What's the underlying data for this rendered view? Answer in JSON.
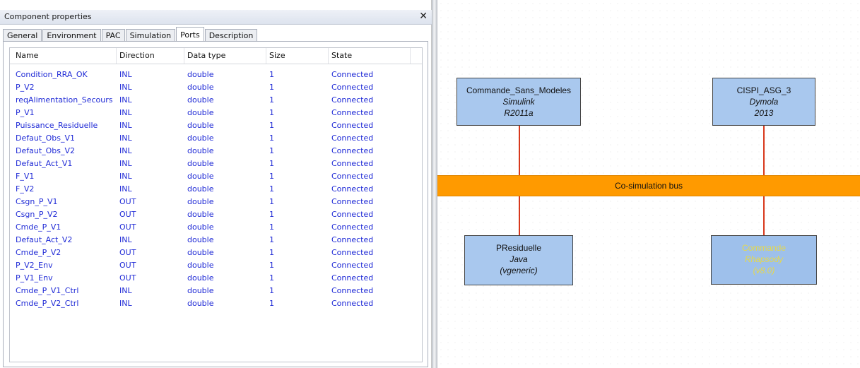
{
  "panel": {
    "title": "Component properties",
    "close_glyph": "✕",
    "tabs": [
      {
        "label": "General",
        "active": false
      },
      {
        "label": "Environment",
        "active": false
      },
      {
        "label": "PAC",
        "active": false
      },
      {
        "label": "Simulation",
        "active": false
      },
      {
        "label": "Ports",
        "active": true
      },
      {
        "label": "Description",
        "active": false
      }
    ]
  },
  "ports_table": {
    "columns": [
      "Name",
      "Direction",
      "Data type",
      "Size",
      "State"
    ],
    "rows": [
      [
        "Condition_RRA_OK",
        "INL",
        "double",
        "1",
        "Connected"
      ],
      [
        "P_V2",
        "INL",
        "double",
        "1",
        "Connected"
      ],
      [
        "reqAlimentation_Secours",
        "INL",
        "double",
        "1",
        "Connected"
      ],
      [
        "P_V1",
        "INL",
        "double",
        "1",
        "Connected"
      ],
      [
        "Puissance_Residuelle",
        "INL",
        "double",
        "1",
        "Connected"
      ],
      [
        "Defaut_Obs_V1",
        "INL",
        "double",
        "1",
        "Connected"
      ],
      [
        "Defaut_Obs_V2",
        "INL",
        "double",
        "1",
        "Connected"
      ],
      [
        "Defaut_Act_V1",
        "INL",
        "double",
        "1",
        "Connected"
      ],
      [
        "F_V1",
        "INL",
        "double",
        "1",
        "Connected"
      ],
      [
        "F_V2",
        "INL",
        "double",
        "1",
        "Connected"
      ],
      [
        "Csgn_P_V1",
        "OUT",
        "double",
        "1",
        "Connected"
      ],
      [
        "Csgn_P_V2",
        "OUT",
        "double",
        "1",
        "Connected"
      ],
      [
        "Cmde_P_V1",
        "OUT",
        "double",
        "1",
        "Connected"
      ],
      [
        "Defaut_Act_V2",
        "INL",
        "double",
        "1",
        "Connected"
      ],
      [
        "Cmde_P_V2",
        "OUT",
        "double",
        "1",
        "Connected"
      ],
      [
        "P_V2_Env",
        "OUT",
        "double",
        "1",
        "Connected"
      ],
      [
        "P_V1_Env",
        "OUT",
        "double",
        "1",
        "Connected"
      ],
      [
        "Cmde_P_V1_Ctrl",
        "INL",
        "double",
        "1",
        "Connected"
      ],
      [
        "Cmde_P_V2_Ctrl",
        "INL",
        "double",
        "1",
        "Connected"
      ]
    ]
  },
  "diagram": {
    "bus_label": "Co-simulation bus",
    "bus_color": "#ff9a00",
    "box_color": "#a9c8ee",
    "wire_color": "#d8381c",
    "components": [
      {
        "name": "Commande_Sans_Modeles",
        "tool": "Simulink",
        "version": "R2011a"
      },
      {
        "name": "CISPI_ASG_3",
        "tool": "Dymola",
        "version": "2013"
      },
      {
        "name": "PResiduelle",
        "tool": "Java",
        "version": "(vgeneric)"
      },
      {
        "name": "Commande",
        "tool": "Rhapsody",
        "version": "(v8.0)"
      }
    ]
  }
}
